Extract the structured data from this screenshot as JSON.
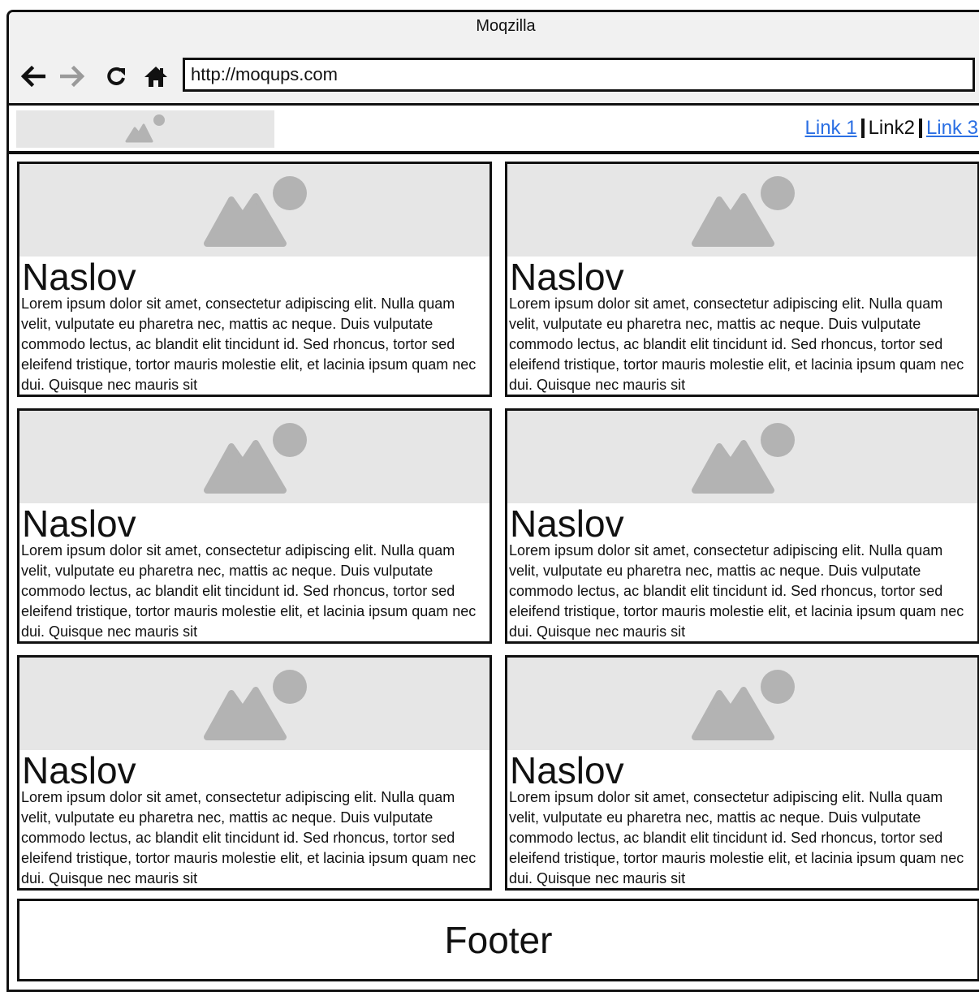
{
  "window": {
    "title": "Moqzilla"
  },
  "toolbar": {
    "back_icon": "arrow-left-icon",
    "forward_icon": "arrow-right-icon",
    "reload_icon": "reload-icon",
    "home_icon": "home-icon",
    "address_value": "http://moqups.com"
  },
  "header": {
    "logo_icon": "image-placeholder-icon",
    "links": [
      {
        "label": "Link 1",
        "active": false
      },
      {
        "label": "Link2",
        "active": true
      },
      {
        "label": "Link 3",
        "active": false
      }
    ]
  },
  "cards": [
    {
      "title": "Naslov",
      "body": "Lorem ipsum dolor sit amet, consectetur adipiscing elit. Nulla quam velit, vulputate eu pharetra nec, mattis ac neque. Duis vulputate commodo lectus, ac blandit elit tincidunt id. Sed rhoncus, tortor sed eleifend tristique, tortor mauris molestie elit, et lacinia ipsum quam nec dui. Quisque nec mauris sit"
    },
    {
      "title": "Naslov",
      "body": "Lorem ipsum dolor sit amet, consectetur adipiscing elit. Nulla quam velit, vulputate eu pharetra nec, mattis ac neque. Duis vulputate commodo lectus, ac blandit elit tincidunt id. Sed rhoncus, tortor sed eleifend tristique, tortor mauris molestie elit, et lacinia ipsum quam nec dui. Quisque nec mauris sit"
    },
    {
      "title": "Naslov",
      "body": "Lorem ipsum dolor sit amet, consectetur adipiscing elit. Nulla quam velit, vulputate eu pharetra nec, mattis ac neque. Duis vulputate commodo lectus, ac blandit elit tincidunt id. Sed rhoncus, tortor sed eleifend tristique, tortor mauris molestie elit, et lacinia ipsum quam nec dui. Quisque nec mauris sit"
    },
    {
      "title": "Naslov",
      "body": "Lorem ipsum dolor sit amet, consectetur adipiscing elit. Nulla quam velit, vulputate eu pharetra nec, mattis ac neque. Duis vulputate commodo lectus, ac blandit elit tincidunt id. Sed rhoncus, tortor sed eleifend tristique, tortor mauris molestie elit, et lacinia ipsum quam nec dui. Quisque nec mauris sit"
    },
    {
      "title": "Naslov",
      "body": "Lorem ipsum dolor sit amet, consectetur adipiscing elit. Nulla quam velit, vulputate eu pharetra nec, mattis ac neque. Duis vulputate commodo lectus, ac blandit elit tincidunt id. Sed rhoncus, tortor sed eleifend tristique, tortor mauris molestie elit, et lacinia ipsum quam nec dui. Quisque nec mauris sit"
    },
    {
      "title": "Naslov",
      "body": "Lorem ipsum dolor sit amet, consectetur adipiscing elit. Nulla quam velit, vulputate eu pharetra nec, mattis ac neque. Duis vulputate commodo lectus, ac blandit elit tincidunt id. Sed rhoncus, tortor sed eleifend tristique, tortor mauris molestie elit, et lacinia ipsum quam nec dui. Quisque nec mauris sit"
    }
  ],
  "footer": {
    "label": "Footer"
  },
  "colors": {
    "link": "#2b6fe3",
    "placeholder_bg": "#e6e6e6",
    "placeholder_icon": "#b3b3b3",
    "border": "#111111"
  }
}
